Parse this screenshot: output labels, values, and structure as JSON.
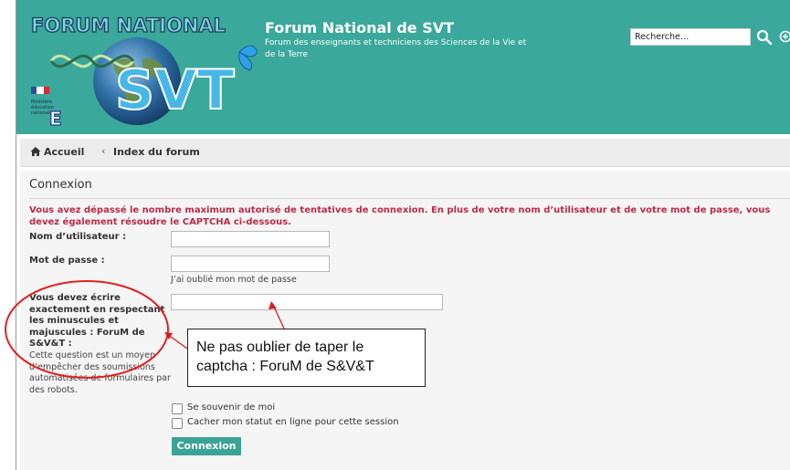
{
  "header": {
    "logo_text_top": "FORUM NATIONAL",
    "logo_text_main": "SVT",
    "site_title": "Forum National de SVT",
    "site_description": "Forum des enseignants et techniciens des Sciences de la Vie et de la Terre",
    "search": {
      "placeholder": "Recherche…",
      "value": "Recherche…"
    },
    "icons": {
      "search": "search-icon",
      "advanced": "advanced-search-icon"
    }
  },
  "breadcrumb": {
    "home_icon": "home-icon",
    "home": "Accueil",
    "separator": "‹",
    "current": "Index du forum"
  },
  "login": {
    "title": "Connexion",
    "error": "Vous avez dépassé le nombre maximum autorisé de tentatives de connexion. En plus de votre nom d’utilisateur et de votre mot de passe, vous devez également résoudre le CAPTCHA ci-dessous.",
    "username_label": "Nom d’utilisateur :",
    "username_value": "",
    "password_label": "Mot de passe :",
    "password_value": "",
    "forgot_link": "J’ai oublié mon mot de passe",
    "captcha_question": "Vous devez écrire exactement en respectant les minuscules et majuscules : ForuM de S&V&T :",
    "captcha_explain": "Cette question est un moyen d’empêcher des soumissions automatisées de formulaires par des robots.",
    "captcha_value": "",
    "remember_me": "Se souvenir de moi",
    "hide_status": "Cacher mon statut en ligne pour cette session",
    "submit": "Connexion"
  },
  "annotation": {
    "text_line1": "Ne pas oublier de taper le",
    "text_line2": "captcha : ForuM de S&V&T"
  },
  "colors": {
    "header_bg": "#3aa89a",
    "error_text": "#bc2a4d",
    "button_bg": "#3ba393",
    "annotation_red": "#e02020"
  }
}
